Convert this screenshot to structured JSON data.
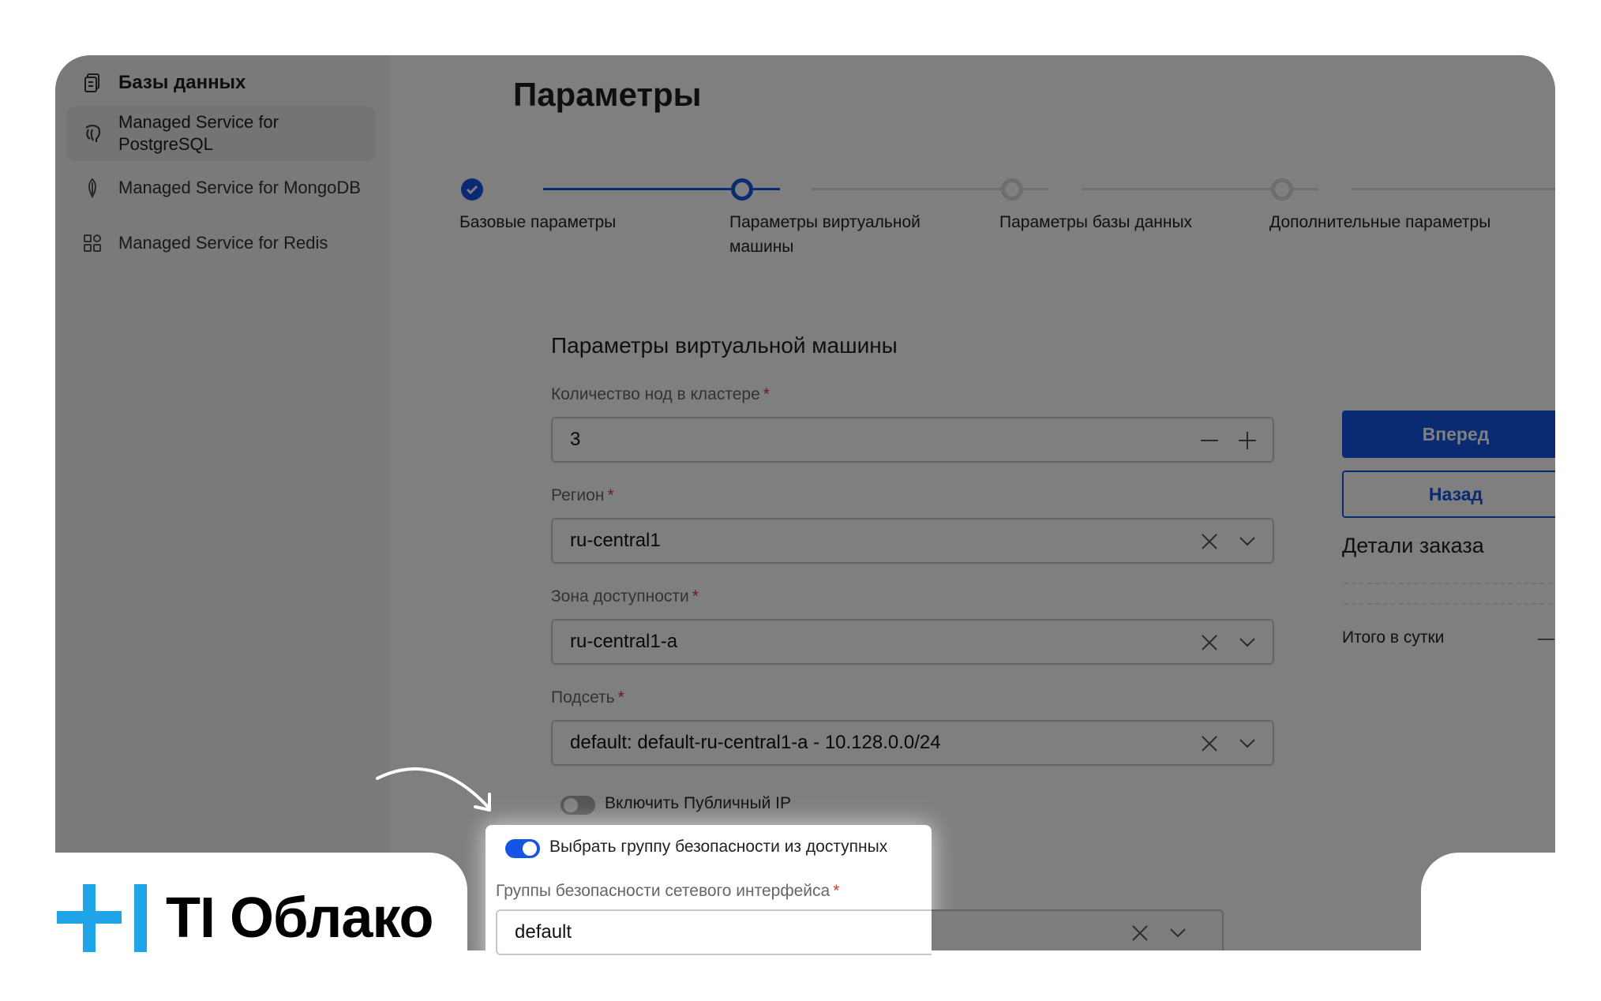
{
  "sidebar": {
    "header": {
      "label": "Базы данных",
      "icon": "database-icon"
    },
    "items": [
      {
        "label": "Managed Service for PostgreSQL",
        "icon": "postgresql-icon",
        "active": true
      },
      {
        "label": "Managed Service for MongoDB",
        "icon": "mongodb-icon",
        "active": false
      },
      {
        "label": "Managed Service for Redis",
        "icon": "redis-icon",
        "active": false
      }
    ]
  },
  "page": {
    "title": "Параметры"
  },
  "stepper": {
    "steps": [
      {
        "label": "Базовые параметры",
        "state": "done"
      },
      {
        "label": "Параметры виртуальной машины",
        "state": "current"
      },
      {
        "label": "Параметры базы данных",
        "state": "pending"
      },
      {
        "label": "Дополнительные параметры",
        "state": "pending"
      }
    ]
  },
  "form": {
    "title": "Параметры виртуальной машины",
    "required_mark": "*",
    "nodes": {
      "label": "Количество нод в кластере",
      "value": "3"
    },
    "region": {
      "label": "Регион",
      "value": "ru-central1"
    },
    "zone": {
      "label": "Зона доступности",
      "value": "ru-central1-a"
    },
    "subnet": {
      "label": "Подсеть",
      "value": "default: default-ru-central1-a - 10.128.0.0/24"
    },
    "public_ip": {
      "label": "Включить Публичный IP",
      "enabled": false
    },
    "security_group_toggle": {
      "label": "Выбрать группу безопасности из доступных",
      "enabled": true
    },
    "security_groups": {
      "label": "Группы безопасности сетевого интерфейса",
      "value": "default"
    }
  },
  "actions": {
    "next_label": "Вперед",
    "back_label": "Назад"
  },
  "order": {
    "title": "Детали заказа",
    "total_label": "Итого в сутки",
    "total_value": "— ₽"
  },
  "brand": {
    "name": "TI Облако"
  },
  "colors": {
    "accent": "#1554e4",
    "logo_blue": "#1fa4e8",
    "overlay": "rgba(0,0,0,0.5)"
  }
}
